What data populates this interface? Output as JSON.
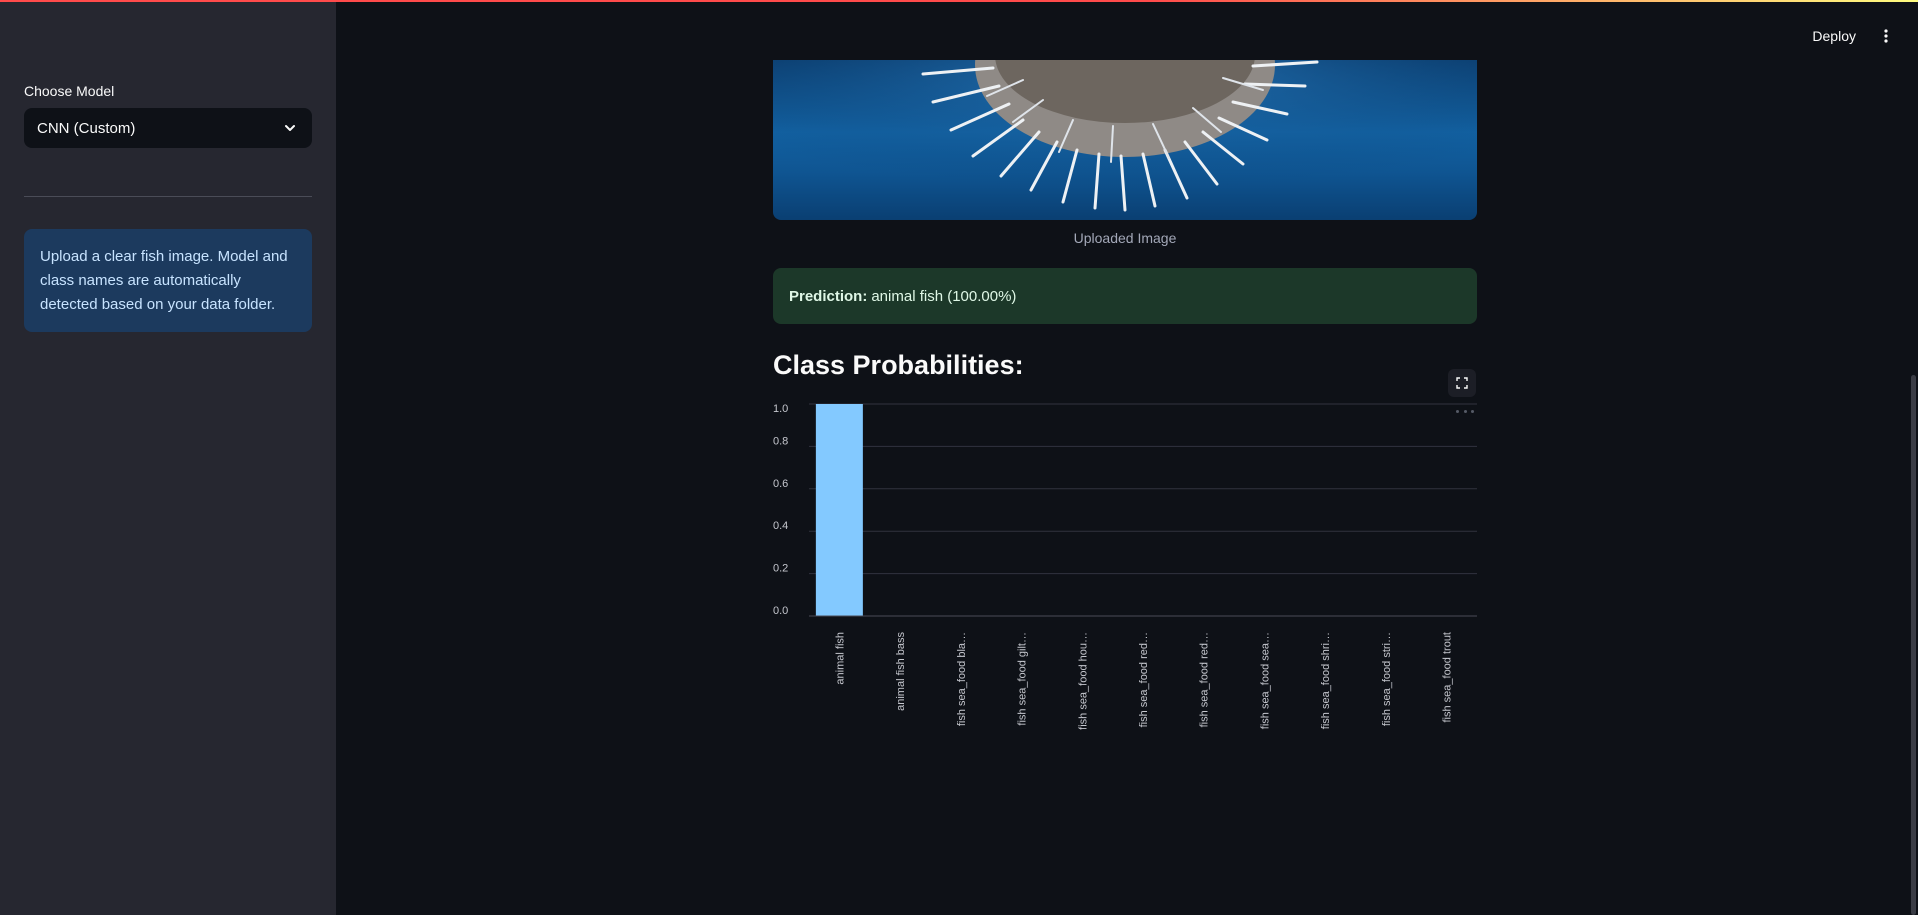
{
  "sidebar": {
    "model_label": "Choose Model",
    "model_selected": "CNN (Custom)",
    "info_text": "Upload a clear fish image. Model and class names are automatically detected based on your data folder."
  },
  "header": {
    "deploy_label": "Deploy"
  },
  "main": {
    "image_caption": "Uploaded Image",
    "prediction_label": "Prediction:",
    "prediction_value": "animal fish (100.00%)",
    "section_title": "Class Probabilities:"
  },
  "colors": {
    "bar": "#83c9ff",
    "background": "#0e1117",
    "sidebar": "#262730"
  },
  "chart_data": {
    "type": "bar",
    "categories": [
      "animal fish",
      "animal fish bass",
      "fish sea_food bla…",
      "fish sea_food gilt…",
      "fish sea_food hou…",
      "fish sea_food red…",
      "fish sea_food red…",
      "fish sea_food sea…",
      "fish sea_food shri…",
      "fish sea_food stri…",
      "fish sea_food trout"
    ],
    "values": [
      1.0,
      0,
      0,
      0,
      0,
      0,
      0,
      0,
      0,
      0,
      0
    ],
    "yticks": [
      "0.0",
      "0.2",
      "0.4",
      "0.6",
      "0.8",
      "1.0"
    ],
    "ylim": [
      0,
      1.0
    ],
    "grid": true
  }
}
